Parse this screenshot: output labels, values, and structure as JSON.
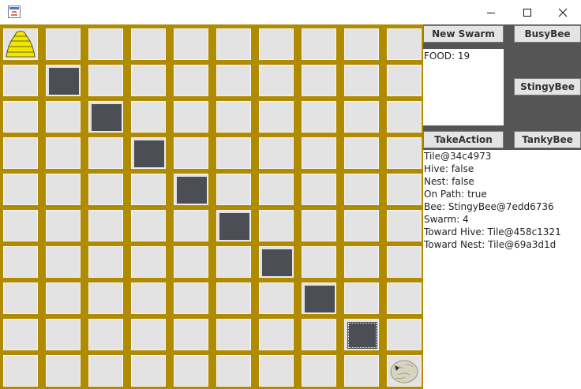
{
  "controls": {
    "new_swarm": "New Swarm",
    "busy_bee": "BusyBee",
    "stingy_bee": "StingyBee",
    "take_action": "TakeAction",
    "tanky_bee": "TankyBee"
  },
  "food_text": "FOOD: 19",
  "tile_info": {
    "tile": "Tile@34c4973",
    "hive": " Hive: false",
    "nest": " Nest: false",
    "on_path": " On Path: true",
    "bee": " Bee: StingyBee@7edd6736",
    "swarm": " Swarm: 4",
    "toward_hive": " Toward Hive: Tile@458c1321",
    "toward_nest": " Toward Nest: Tile@69a3d1d"
  },
  "board": {
    "rows": 10,
    "cols": 10,
    "path_cells": [
      [
        1,
        1
      ],
      [
        2,
        2
      ],
      [
        3,
        3
      ],
      [
        4,
        4
      ],
      [
        5,
        5
      ],
      [
        6,
        6
      ],
      [
        7,
        7
      ],
      [
        8,
        8
      ]
    ],
    "selected_cell": [
      8,
      8
    ],
    "hive_cell": [
      0,
      0
    ],
    "nest_cell": [
      9,
      9
    ]
  },
  "colors": {
    "board_grid": "#b08b00",
    "path_tile": "#4b4f55",
    "tile": "#e3e3e3",
    "hive": "#f2e600"
  },
  "icons": {
    "app": "java-app-icon",
    "minimize": "minimize-icon",
    "maximize": "maximize-icon",
    "close": "close-icon"
  }
}
